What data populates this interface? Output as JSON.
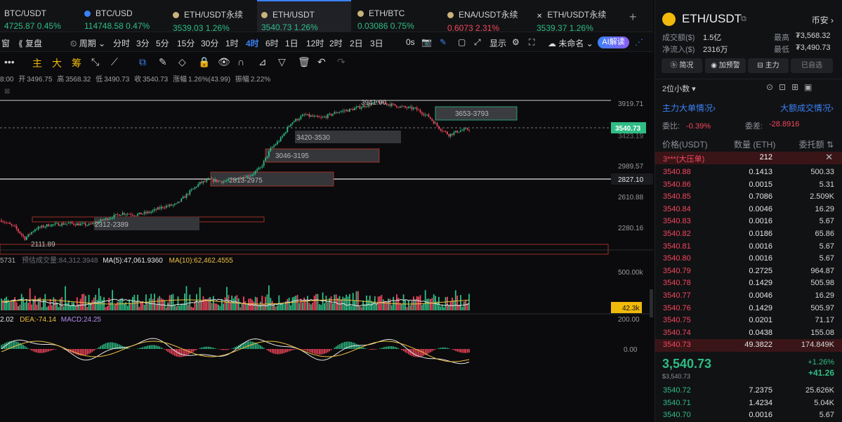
{
  "tabs": [
    {
      "name": "BTC/USDT",
      "price": "4725.87",
      "chg": "0.45%",
      "color": "#2ebd85"
    },
    {
      "name": "BTC/USD",
      "price": "114748.58",
      "chg": "0.47%",
      "color": "#2ebd85"
    },
    {
      "name": "ETH/USDT永续",
      "price": "3539.03",
      "chg": "1.26%",
      "color": "#2ebd85"
    },
    {
      "name": "ETH/USDT",
      "price": "3540.73",
      "chg": "1.26%",
      "color": "#2ebd85"
    },
    {
      "name": "ETH/BTC",
      "price": "0.03086",
      "chg": "0.75%",
      "color": "#2ebd85"
    },
    {
      "name": "ENA/USDT永续",
      "price": "0.6073",
      "chg": "2.31%",
      "color": "#f6465d"
    },
    {
      "name": "ETH/USDT永续",
      "price": "3539.37",
      "chg": "1.26%",
      "color": "#2ebd85"
    }
  ],
  "add_tab": "+",
  "toolbar": {
    "window": "窗",
    "replay": "复盘",
    "period": "周期",
    "intervals": [
      "分时",
      "3分",
      "5分",
      "15分",
      "30分",
      "1时",
      "4时",
      "6时",
      "1日",
      "12时",
      "2时",
      "2日",
      "3日"
    ],
    "selected": "4时",
    "seconds": "0s",
    "display": "显示",
    "unnamed": "未命名",
    "ai": "AI解读"
  },
  "drawbar": {
    "more": "•••",
    "main": "主",
    "big": "大",
    "chips": "筹"
  },
  "ohlc": {
    "time": "8:00",
    "open_lbl": "开",
    "open": "3496.75",
    "high_lbl": "高",
    "high": "3568.32",
    "low_lbl": "低",
    "low": "3490.73",
    "close_lbl": "收",
    "close": "3540.73",
    "chg_lbl": "涨幅",
    "chg": "1.26%(43.99)",
    "amp_lbl": "振幅",
    "amp": "2.22%"
  },
  "price_axis": {
    "labels": [
      "3919.71",
      "2989.57",
      "2610.88",
      "2280.16"
    ],
    "current": "3540.73",
    "line_label": "2827.10",
    "hidden": "3423.19"
  },
  "annotations": {
    "peak": "3941.00",
    "low": "2111.89",
    "zones": [
      "3653-3793",
      "3420-3530",
      "3046-3195",
      "2813-2975",
      "2312-2389"
    ]
  },
  "volume": {
    "prefix": "5731",
    "forecast": "预估成交量:84,312.3948",
    "ma5": "MA(5):47,061.9360",
    "ma10": "MA(10):62,462.4555",
    "axis_top": "500.00k",
    "current": "42.3k"
  },
  "macd": {
    "dif": "2.02",
    "dea": "DEA:-74.14",
    "macd": "MACD:24.25",
    "axis_top": "200.00",
    "axis_zero": "0.00"
  },
  "chart_data": {
    "type": "candlestick",
    "pair": "ETH/USDT",
    "interval": "4时",
    "high": 3941.0,
    "low": 2111.89,
    "last": 3540.73,
    "ylim": [
      2111.89,
      3941.0
    ]
  },
  "panel": {
    "symbol": "ETH/USDT",
    "exchange": "币安",
    "turnover_lbl": "成交额($)",
    "turnover": "1.5亿",
    "high_lbl": "最高",
    "high": "₮3,568.32",
    "inflow_lbl": "净流入($)",
    "inflow": "2316万",
    "low_lbl": "最低",
    "low": "₮3,490.73",
    "buttons": [
      "简况",
      "加预警",
      "主力",
      "已自选"
    ],
    "decimals": "2位小数",
    "main_big": "主力大单情况",
    "big_trades": "大额成交情况",
    "ratio_lbl": "委比:",
    "ratio": "-0.39%",
    "diff_lbl": "委差:",
    "diff": "-28.8916",
    "col_price": "价格(USDT)",
    "col_qty": "数量 (ETH)",
    "col_total": "委托额",
    "pressure_label": "3***(大压单)",
    "pressure_qty": "212",
    "asks": [
      [
        "3540.88",
        "0.1413",
        "500.33"
      ],
      [
        "3540.86",
        "0.0015",
        "5.31"
      ],
      [
        "3540.85",
        "0.7086",
        "2.509K"
      ],
      [
        "3540.84",
        "0.0046",
        "16.29"
      ],
      [
        "3540.83",
        "0.0016",
        "5.67"
      ],
      [
        "3540.82",
        "0.0186",
        "65.86"
      ],
      [
        "3540.81",
        "0.0016",
        "5.67"
      ],
      [
        "3540.80",
        "0.0016",
        "5.67"
      ],
      [
        "3540.79",
        "0.2725",
        "964.87"
      ],
      [
        "3540.78",
        "0.1429",
        "505.98"
      ],
      [
        "3540.77",
        "0.0046",
        "16.29"
      ],
      [
        "3540.76",
        "0.1429",
        "505.97"
      ],
      [
        "3540.75",
        "0.0201",
        "71.17"
      ],
      [
        "3540.74",
        "0.0438",
        "155.08"
      ],
      [
        "3540.73",
        "49.3822",
        "174.849K"
      ]
    ],
    "last_price": "3,540.73",
    "last_usd": "$3,540.73",
    "last_pct": "+1.26%",
    "last_chg": "+41.26",
    "bids": [
      [
        "3540.72",
        "7.2375",
        "25.626K"
      ],
      [
        "3540.71",
        "1.4234",
        "5.04K"
      ],
      [
        "3540.70",
        "0.0016",
        "5.67"
      ]
    ]
  }
}
